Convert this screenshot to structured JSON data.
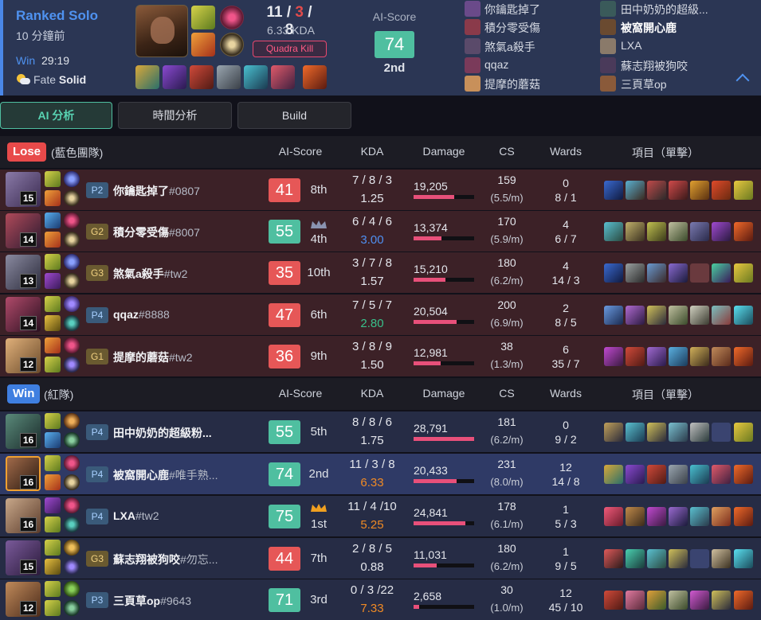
{
  "header": {
    "queue": "Ranked Solo",
    "ago": "10 分鐘前",
    "result": "Win",
    "duration": "29:19",
    "weather_prefix": "Fate",
    "weather": "Solid",
    "kills": "11",
    "deaths": "3",
    "assists": "8",
    "kda_ratio": "6.33 KDA",
    "multikill": "Quadra Kill",
    "ai_label": "AI-Score",
    "ai_score": "74",
    "ai_rank": "2nd"
  },
  "participants_left": [
    "你鑰匙掉了",
    "積分零受傷",
    "煞氣a殺手",
    "qqaz",
    "提摩的蘑菇"
  ],
  "participants_right": [
    "田中奶奶的超級...",
    "被窩開心鹿",
    "LXA",
    "蘇志翔被狗咬",
    "三頁草op"
  ],
  "tabs": [
    "AI 分析",
    "時間分析",
    "Build"
  ],
  "columns": {
    "ai": "AI-Score",
    "kda": "KDA",
    "damage": "Damage",
    "cs": "CS",
    "wards": "Wards",
    "items": "項目（單擊）"
  },
  "blue_team": {
    "label": "Lose",
    "name": "(藍色團隊)",
    "color": "#e84a4a",
    "players": [
      {
        "level": "15",
        "rank": "P2",
        "name": "你鑰匙掉了",
        "tag": "#0807",
        "score": "41",
        "pos": "8th",
        "kda": "7 / 8 / 3",
        "ratio": "1.25",
        "damage": "19,205",
        "dmg_pct": 0.67,
        "cs": "159",
        "cspm": "(5.5/m)",
        "wards": "0",
        "wk": "8 / 1"
      },
      {
        "level": "14",
        "rank": "G2",
        "name": "積分零受傷",
        "tag": "#8007",
        "score": "55",
        "pos": "4th",
        "kda": "6 / 4 / 6",
        "ratio": "3.00",
        "damage": "13,374",
        "dmg_pct": 0.46,
        "cs": "170",
        "cspm": "(5.9/m)",
        "wards": "4",
        "wk": "6 / 7"
      },
      {
        "level": "13",
        "rank": "G3",
        "name": "煞氣a殺手",
        "tag": "#tw2",
        "score": "35",
        "pos": "10th",
        "kda": "3 / 7 / 8",
        "ratio": "1.57",
        "damage": "15,210",
        "dmg_pct": 0.53,
        "cs": "180",
        "cspm": "(6.2/m)",
        "wards": "4",
        "wk": "14 / 3"
      },
      {
        "level": "14",
        "rank": "P4",
        "name": "qqaz",
        "tag": "#8888",
        "score": "47",
        "pos": "6th",
        "kda": "7 / 5 / 7",
        "ratio": "2.80",
        "damage": "20,504",
        "dmg_pct": 0.71,
        "cs": "200",
        "cspm": "(6.9/m)",
        "wards": "2",
        "wk": "8 / 5"
      },
      {
        "level": "12",
        "rank": "G1",
        "name": "提摩的蘑菇",
        "tag": "#tw2",
        "score": "36",
        "pos": "9th",
        "kda": "3 / 8 / 9",
        "ratio": "1.50",
        "damage": "12,981",
        "dmg_pct": 0.45,
        "cs": "38",
        "cspm": "(1.3/m)",
        "wards": "6",
        "wk": "35 / 7"
      }
    ]
  },
  "red_team": {
    "label": "Win",
    "name": "(紅隊)",
    "color": "#3f7fe0",
    "players": [
      {
        "level": "16",
        "rank": "P4",
        "name": "田中奶奶的超級粉...",
        "tag": "",
        "score": "55",
        "pos": "5th",
        "kda": "8 / 8 / 6",
        "ratio": "1.75",
        "damage": "28,791",
        "dmg_pct": 1.0,
        "cs": "181",
        "cspm": "(6.2/m)",
        "wards": "0",
        "wk": "9 / 2"
      },
      {
        "level": "16",
        "rank": "P4",
        "name": "被窩開心鹿",
        "tag": "#唯手熟...",
        "score": "74",
        "pos": "2nd",
        "kda": "11 / 3 / 8",
        "ratio": "6.33",
        "damage": "20,433",
        "dmg_pct": 0.71,
        "cs": "231",
        "cspm": "(8.0/m)",
        "wards": "12",
        "wk": "14 / 8"
      },
      {
        "level": "16",
        "rank": "P4",
        "name": "LXA",
        "tag": "#tw2",
        "score": "75",
        "pos": "1st",
        "kda": "11 / 4 /10",
        "ratio": "5.25",
        "damage": "24,841",
        "dmg_pct": 0.86,
        "cs": "178",
        "cspm": "(6.1/m)",
        "wards": "1",
        "wk": "5 / 3"
      },
      {
        "level": "15",
        "rank": "G3",
        "name": "蘇志翔被狗咬",
        "tag": "#勿忘...",
        "score": "44",
        "pos": "7th",
        "kda": "2 / 8 / 5",
        "ratio": "0.88",
        "damage": "11,031",
        "dmg_pct": 0.38,
        "cs": "180",
        "cspm": "(6.2/m)",
        "wards": "1",
        "wk": "9 / 5"
      },
      {
        "level": "12",
        "rank": "P3",
        "name": "三頁草op",
        "tag": "#9643",
        "score": "71",
        "pos": "3rd",
        "kda": "0 / 3 /22",
        "ratio": "7.33",
        "damage": "2,658",
        "dmg_pct": 0.09,
        "cs": "30",
        "cspm": "(1.0/m)",
        "wards": "12",
        "wk": "45 / 10"
      }
    ]
  },
  "colors": {
    "lose_row": "#3c2127",
    "win_row": "#262c45",
    "my_row": "#2f3a66",
    "score_red": "#e65757",
    "score_green": "#4fbfa0",
    "ratio_blue": "#4f8ff0",
    "ratio_green": "#38c08a",
    "ratio_orange": "#f08a24",
    "damage_bar": "#e8507a"
  }
}
